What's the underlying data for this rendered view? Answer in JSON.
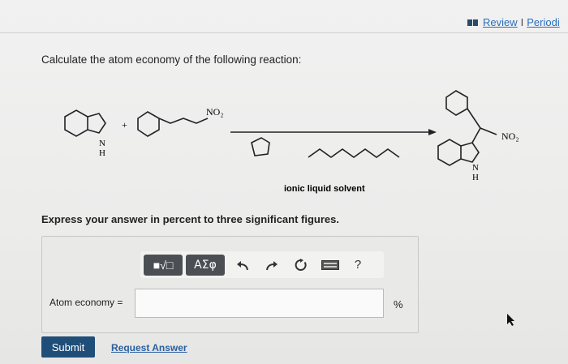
{
  "header": {
    "review_label": "Review",
    "separator": "I",
    "periodic_label": "Periodi"
  },
  "question": {
    "text": "Calculate the atom economy of the following reaction:",
    "prompt": "Express your answer in percent to three significant figures."
  },
  "scheme": {
    "plus": "+",
    "no2_label": "NO₂",
    "indole_n": "N",
    "indole_h": "H",
    "catalyst_label": "ionic liquid solvent",
    "product_no2": "NO₂",
    "product_n": "N",
    "product_h": "H"
  },
  "toolbar": {
    "template_label": "■√□",
    "greek_label": "ΑΣφ",
    "help_label": "?"
  },
  "answer": {
    "label": "Atom economy =",
    "value": "",
    "unit": "%"
  },
  "buttons": {
    "submit": "Submit",
    "request_answer": "Request Answer"
  }
}
